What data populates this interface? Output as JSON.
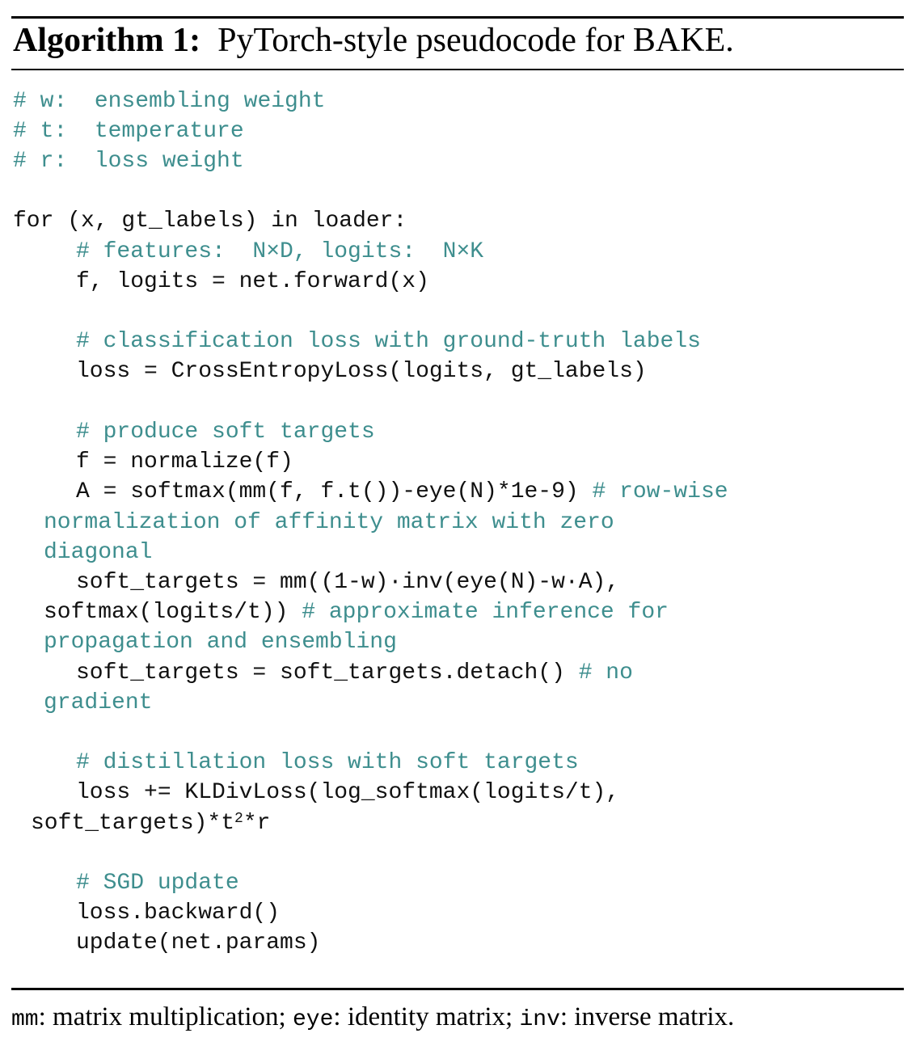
{
  "algorithm": {
    "label": "Algorithm 1:",
    "caption": "PyTorch-style pseudocode for BAKE."
  },
  "code": {
    "c_w": "# w:  ensembling weight",
    "c_t": "# t:  temperature",
    "c_r": "# r:  loss weight",
    "for_line": "for (x, gt_labels) in loader:",
    "c_features": "# features:  N×D, logits:  N×K",
    "forward": "f, logits = net.forward(x)",
    "c_cls": "# classification loss with ground-truth labels",
    "ce_loss": "loss = CrossEntropyLoss(logits, gt_labels)",
    "c_soft": "# produce soft targets",
    "normalize": "f = normalize(f)",
    "affinity_code": "A = softmax(mm(f, f.t())-eye(N)*1e-9) ",
    "affinity_comment_1": "# row-wise",
    "affinity_comment_2": "normalization of affinity matrix with zero",
    "affinity_comment_3": "diagonal",
    "soft_targets_1": "soft_targets = mm((1-w)·inv(eye(N)-w·A),",
    "soft_targets_2_code": "softmax(logits/t)) ",
    "soft_targets_2_comment": "# approximate inference for",
    "soft_targets_3_comment": "propagation and ensembling",
    "detach_code": "soft_targets = soft_targets.detach() ",
    "detach_comment_1": "# no",
    "detach_comment_2": "gradient",
    "c_distill": "# distillation loss with soft targets",
    "kl_1": "loss += KLDivLoss(log_softmax(logits/t),",
    "kl_2a": "soft_targets)*t",
    "kl_2_sup": "2",
    "kl_2b": "*r",
    "c_sgd": "# SGD update",
    "backward": "loss.backward()",
    "update": "update(net.params)"
  },
  "footer": {
    "mm": "mm",
    "mm_desc": ": matrix multiplication; ",
    "eye": "eye",
    "eye_desc": ": identity matrix; ",
    "inv": "inv",
    "inv_desc": ": inverse matrix."
  },
  "colors": {
    "comment": "#3e8e8e",
    "code": "#111111"
  }
}
